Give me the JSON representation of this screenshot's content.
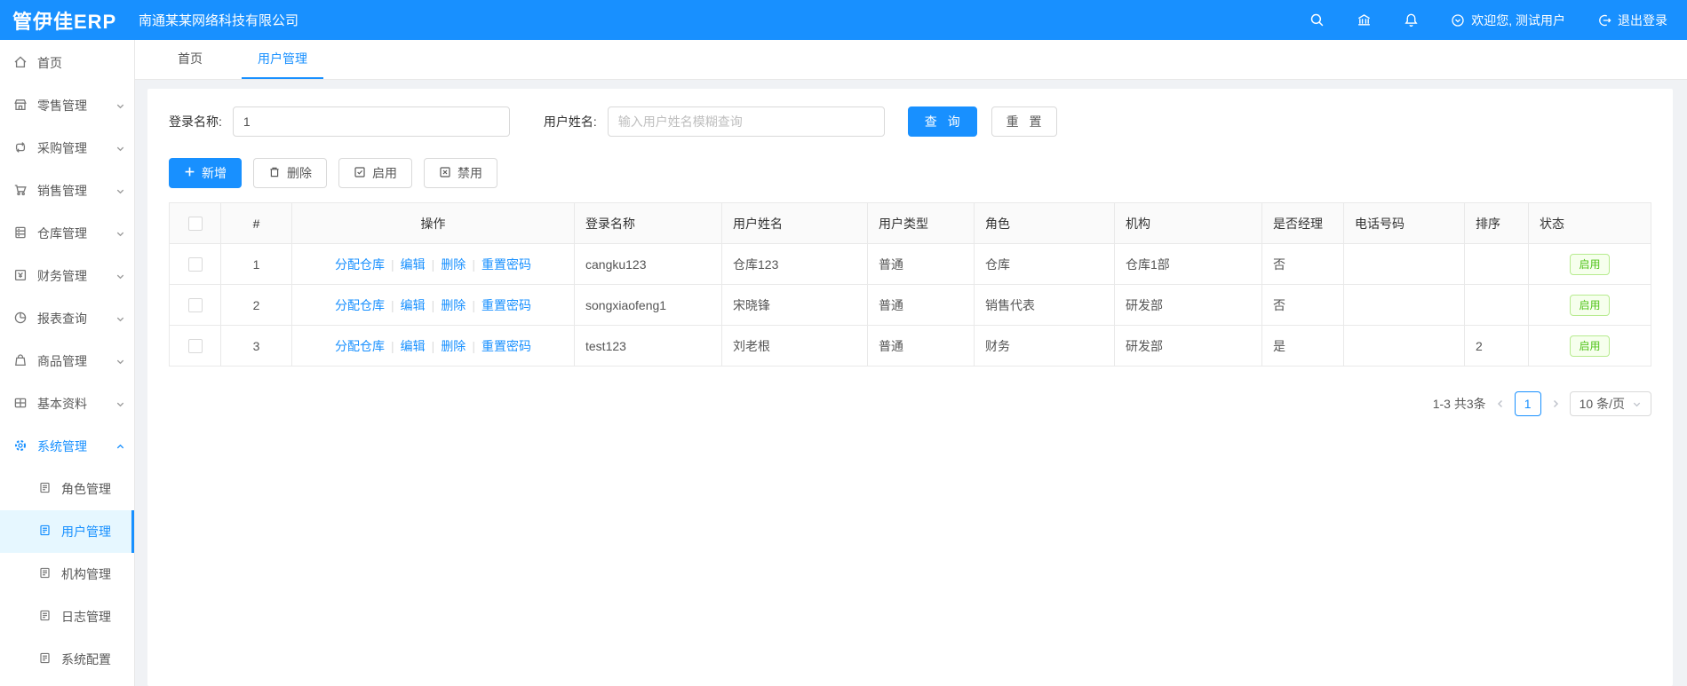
{
  "header": {
    "logo": "管伊佳ERP",
    "company": "南通某某网络科技有限公司",
    "welcome": "欢迎您, 测试用户",
    "logout": "退出登录"
  },
  "sidebar": {
    "items": [
      {
        "label": "首页",
        "icon": "home-icon"
      },
      {
        "label": "零售管理",
        "icon": "shop-icon"
      },
      {
        "label": "采购管理",
        "icon": "sync-icon"
      },
      {
        "label": "销售管理",
        "icon": "cart-icon"
      },
      {
        "label": "仓库管理",
        "icon": "warehouse-icon"
      },
      {
        "label": "财务管理",
        "icon": "finance-icon"
      },
      {
        "label": "报表查询",
        "icon": "pie-chart-icon"
      },
      {
        "label": "商品管理",
        "icon": "bag-icon"
      },
      {
        "label": "基本资料",
        "icon": "grid-icon"
      },
      {
        "label": "系统管理",
        "icon": "gear-icon",
        "children": [
          {
            "label": "角色管理"
          },
          {
            "label": "用户管理"
          },
          {
            "label": "机构管理"
          },
          {
            "label": "日志管理"
          },
          {
            "label": "系统配置"
          }
        ]
      }
    ]
  },
  "tabs": [
    {
      "label": "首页"
    },
    {
      "label": "用户管理"
    }
  ],
  "filter": {
    "login_label": "登录名称:",
    "login_value": "1",
    "name_label": "用户姓名:",
    "name_placeholder": "输入用户姓名模糊查询",
    "search": "查 询",
    "reset": "重 置"
  },
  "toolbar": {
    "add": "新增",
    "delete": "删除",
    "enable": "启用",
    "disable": "禁用"
  },
  "table": {
    "columns": [
      "#",
      "操作",
      "登录名称",
      "用户姓名",
      "用户类型",
      "角色",
      "机构",
      "是否经理",
      "电话号码",
      "排序",
      "状态"
    ],
    "op_links": [
      "分配仓库",
      "编辑",
      "删除",
      "重置密码"
    ],
    "rows": [
      {
        "index": "1",
        "login": "cangku123",
        "name": "仓库123",
        "type": "普通",
        "role": "仓库",
        "org": "仓库1部",
        "manager": "否",
        "phone": "",
        "sort": "",
        "status": "启用"
      },
      {
        "index": "2",
        "login": "songxiaofeng1",
        "name": "宋晓锋",
        "type": "普通",
        "role": "销售代表",
        "org": "研发部",
        "manager": "否",
        "phone": "",
        "sort": "",
        "status": "启用"
      },
      {
        "index": "3",
        "login": "test123",
        "name": "刘老根",
        "type": "普通",
        "role": "财务",
        "org": "研发部",
        "manager": "是",
        "phone": "",
        "sort": "2",
        "status": "启用"
      }
    ]
  },
  "pagination": {
    "total": "1-3 共3条",
    "page": "1",
    "page_size": "10 条/页"
  },
  "colors": {
    "primary": "#1890ff",
    "sidebar_active_bg": "#e6f7ff",
    "tag_green_text": "#52c41a",
    "tag_green_bg": "#f6ffed",
    "tag_green_border": "#b7eb8f",
    "table_header_bg": "#fafafa"
  }
}
